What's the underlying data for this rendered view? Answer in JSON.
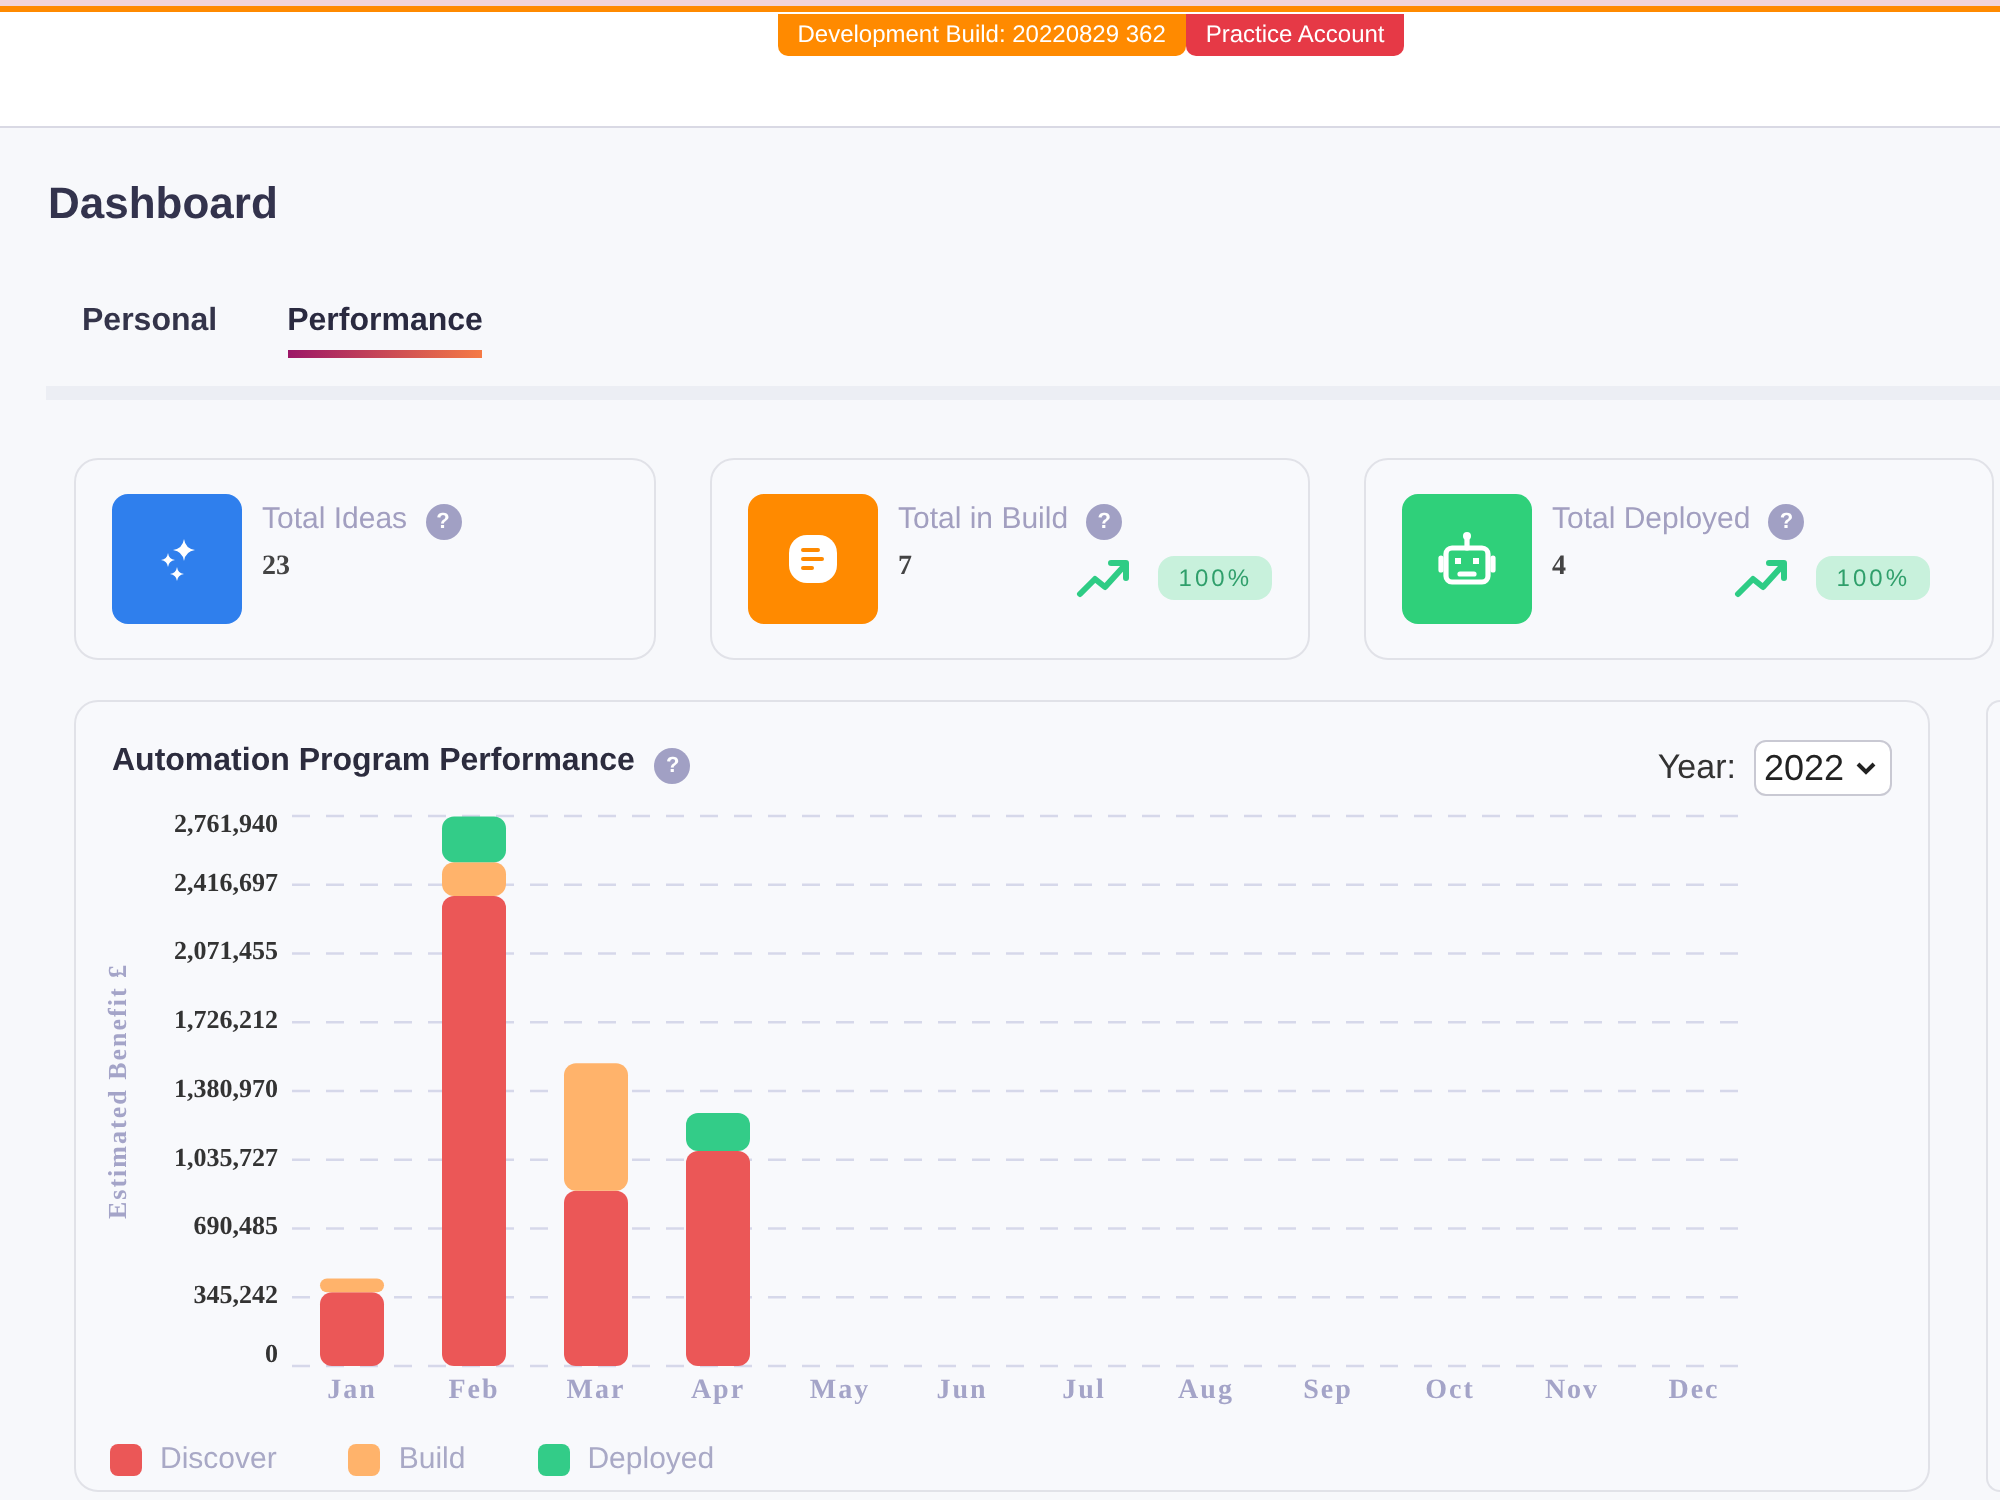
{
  "header": {
    "badges": [
      {
        "text": "Development Build: 20220829 362",
        "color": "#ff8a00"
      },
      {
        "text": "Practice Account",
        "color": "#e63946"
      }
    ]
  },
  "page": {
    "title": "Dashboard"
  },
  "tabs": [
    {
      "label": "Personal",
      "selected": false
    },
    {
      "label": "Performance",
      "selected": true
    }
  ],
  "stats": [
    {
      "kind": "ideas",
      "color": "#2f7fed",
      "label": "Total Ideas",
      "help": "?",
      "value": "23"
    },
    {
      "kind": "build",
      "color": "#ff8a00",
      "label": "Total in Build",
      "help": "?",
      "value": "7",
      "change": "100%"
    },
    {
      "kind": "deployed",
      "color": "#2fd07a",
      "label": "Total Deployed",
      "help": "?",
      "value": "4",
      "change": "100%"
    }
  ],
  "chart_panel": {
    "title": "Automation Program Performance",
    "help": "?",
    "year_select": {
      "label": "Year:",
      "value": "2022"
    },
    "chart_data": {
      "type": "bar",
      "stacked": true,
      "grid": true,
      "ylabel": "Estimated Benefit £",
      "categories": [
        "Jan",
        "Feb",
        "Mar",
        "Apr",
        "May",
        "Jun",
        "Jul",
        "Aug",
        "Sep",
        "Oct",
        "Nov",
        "Dec"
      ],
      "series": [
        {
          "name": "Discover",
          "color": "#eb5757",
          "values": [
            370000,
            2360000,
            880000,
            1080000,
            null,
            null,
            null,
            null,
            null,
            null,
            null,
            null
          ]
        },
        {
          "name": "Build",
          "color": "#ffb36b",
          "values": [
            70000,
            170000,
            640000,
            null,
            null,
            null,
            null,
            null,
            null,
            null,
            null,
            null
          ]
        },
        {
          "name": "Deployed",
          "color": "#33cc88",
          "values": [
            null,
            230000,
            null,
            190000,
            null,
            null,
            null,
            null,
            null,
            null,
            null,
            null
          ]
        }
      ],
      "ylim": [
        0,
        2761940
      ],
      "yticks": [
        {
          "value": 0,
          "label": "0"
        },
        {
          "value": 345242.5,
          "label": "345,242"
        },
        {
          "value": 690485,
          "label": "690,485"
        },
        {
          "value": 1035727.5,
          "label": "1,035,727"
        },
        {
          "value": 1380970,
          "label": "1,380,970"
        },
        {
          "value": 1726212.5,
          "label": "1,726,212"
        },
        {
          "value": 2071455,
          "label": "2,071,455"
        },
        {
          "value": 2416697.5,
          "label": "2,416,697"
        },
        {
          "value": 2761940,
          "label": "2,761,940"
        }
      ]
    }
  }
}
